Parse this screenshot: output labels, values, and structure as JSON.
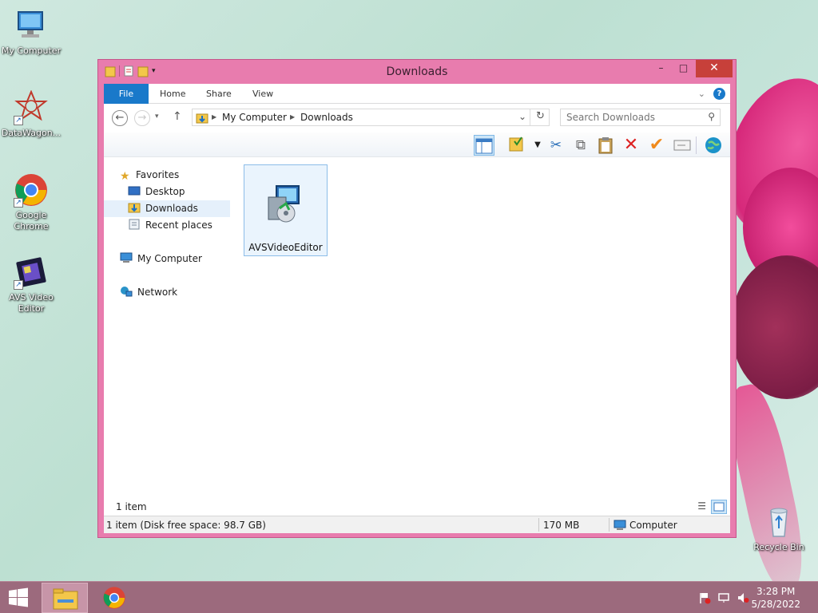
{
  "desktop": {
    "icons": [
      {
        "label": "My Computer"
      },
      {
        "label": "DataWagon..."
      },
      {
        "label": "Google Chrome"
      },
      {
        "label": "AVS Video Editor"
      },
      {
        "label": "Recycle Bin"
      }
    ]
  },
  "window": {
    "title": "Downloads",
    "controls": {
      "minimize": "–",
      "maximize": "□",
      "close": "✕"
    },
    "ribbon": {
      "tabs": [
        "File",
        "Home",
        "Share",
        "View"
      ],
      "help": "?"
    },
    "address": {
      "segments": [
        "My Computer",
        "Downloads"
      ],
      "refresh_icon": "refresh-icon"
    },
    "search": {
      "placeholder": "Search Downloads"
    },
    "sidebar": {
      "favorites": "Favorites",
      "desktop": "Desktop",
      "downloads": "Downloads",
      "recent_places": "Recent places",
      "my_computer": "My Computer",
      "network": "Network"
    },
    "files": [
      {
        "name": "AVSVideoEditor"
      }
    ],
    "item_count": "1 item",
    "status": {
      "left": "1 item (Disk free space: 98.7 GB)",
      "size": "170 MB",
      "location": "Computer"
    }
  },
  "taskbar": {
    "time": "3:28 PM",
    "date": "5/28/2022"
  },
  "colors": {
    "window_frame": "#e87cae",
    "file_tab": "#1979ca",
    "taskbar": "#9c6a7d",
    "close_button": "#c7403a"
  }
}
